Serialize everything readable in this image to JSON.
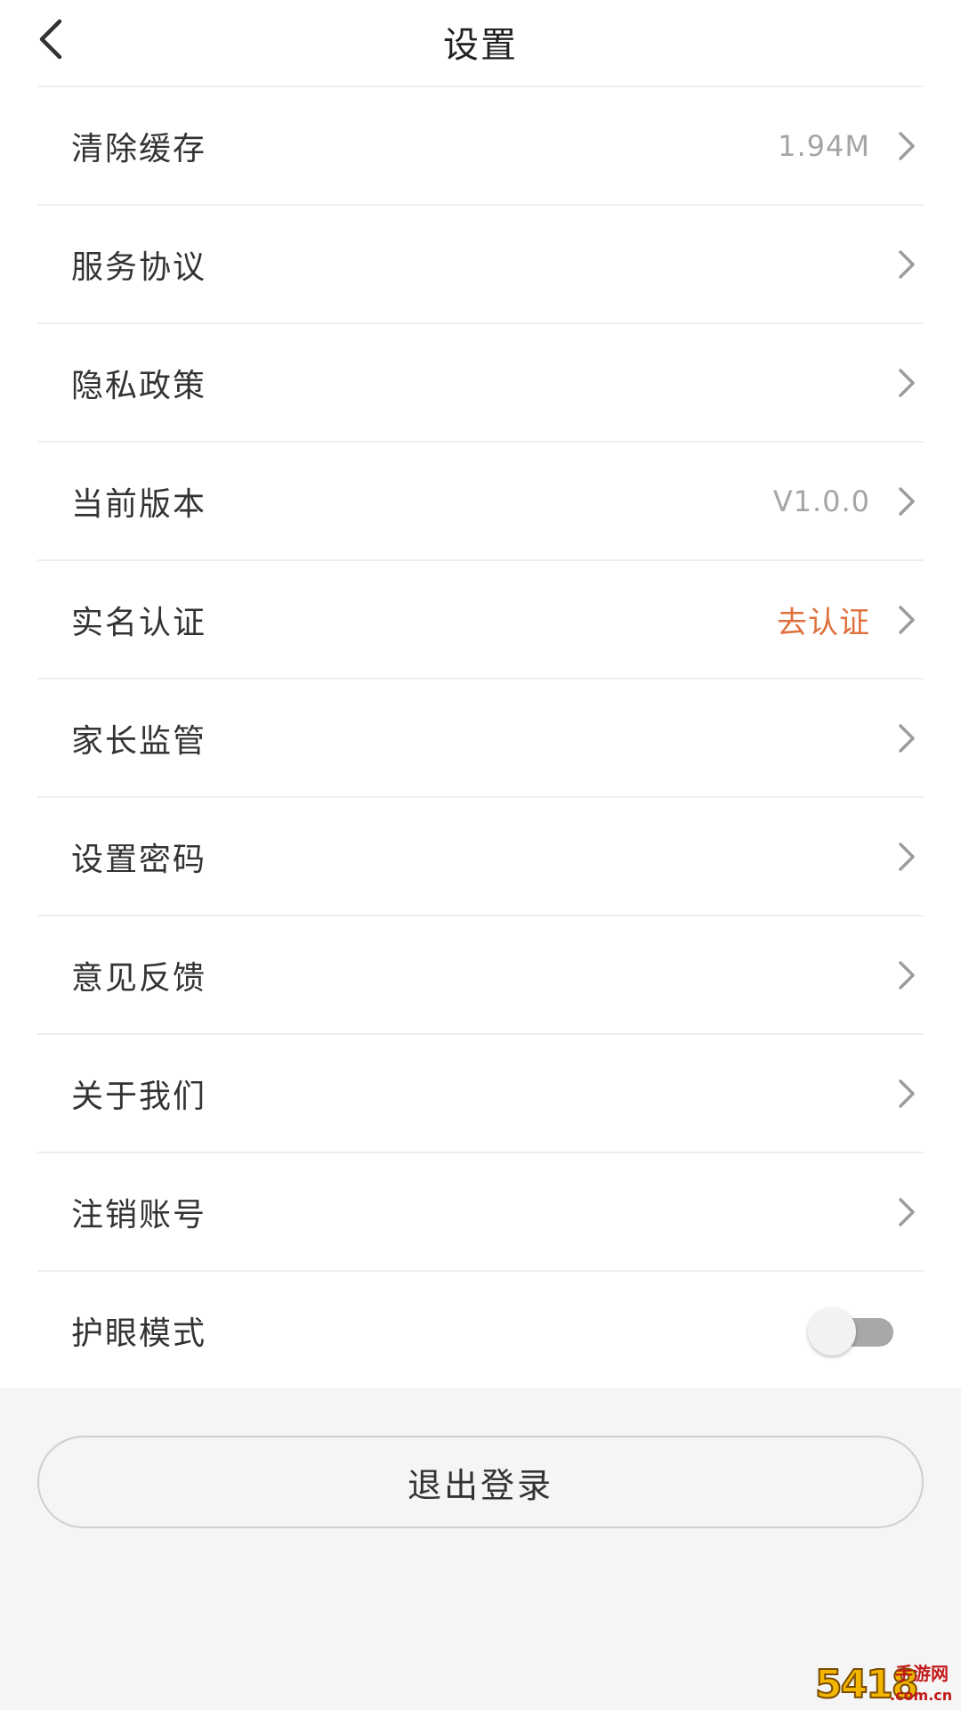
{
  "header": {
    "title": "设置"
  },
  "settings": {
    "items": [
      {
        "label": "清除缓存",
        "value": "1.94M"
      },
      {
        "label": "服务协议",
        "value": ""
      },
      {
        "label": "隐私政策",
        "value": ""
      },
      {
        "label": "当前版本",
        "value": "V1.0.0"
      },
      {
        "label": "实名认证",
        "value": "去认证"
      },
      {
        "label": "家长监管",
        "value": ""
      },
      {
        "label": "设置密码",
        "value": ""
      },
      {
        "label": "意见反馈",
        "value": ""
      },
      {
        "label": "关于我们",
        "value": ""
      },
      {
        "label": "注销账号",
        "value": ""
      }
    ],
    "eye_mode": {
      "label": "护眼模式",
      "enabled": false
    }
  },
  "logout": {
    "label": "退出登录"
  },
  "watermark": {
    "big": "5418",
    "small": "手游网",
    "domain": ".com.cn"
  },
  "colors": {
    "accent": "#e0703d",
    "secondary_text": "#a5a5a5",
    "primary_text": "#333333",
    "background": "#f5f5f5",
    "toggle_off_track": "#a8a8a8"
  },
  "icons": {
    "back": "back-arrow-icon",
    "row_arrow": "chevron-right-icon"
  }
}
